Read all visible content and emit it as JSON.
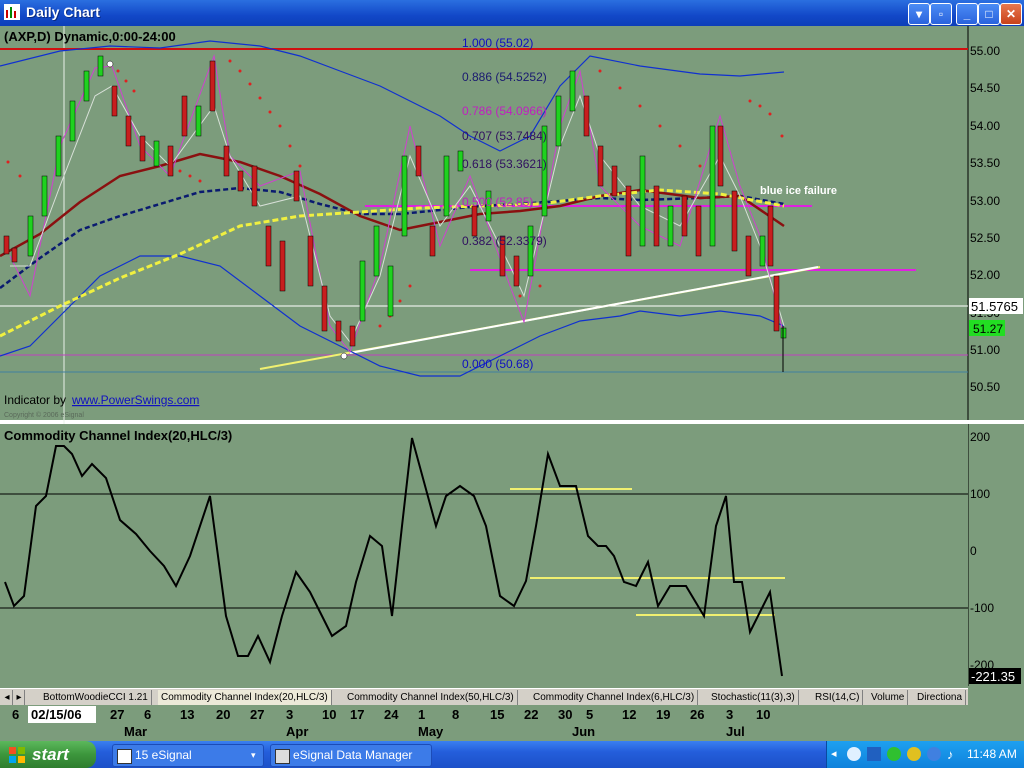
{
  "window": {
    "title": "Daily Chart"
  },
  "chart": {
    "header": "(AXP,D) Dynamic,0:00-24:00",
    "indicator_by": "Indicator by",
    "link": "www.PowerSwings.com",
    "copyright": "Copyright © 2006 eSignal",
    "annotation": "blue ice failure",
    "fib_labels": [
      "1.000 (55.02)",
      "0.886 (54.5252)",
      "0.786 (54.0966)",
      "0.707 (53.7484)",
      "0.618 (53.3621)",
      "0.500 (52.85)",
      "0.382 (52.3379)",
      "0.000 (50.68)"
    ],
    "price_ticks": [
      "55.00",
      "54.50",
      "54.00",
      "53.50",
      "53.00",
      "52.50",
      "52.00",
      "51.50",
      "51.00",
      "50.50"
    ],
    "last_price": "51.5765",
    "current_price": "51.27",
    "colors": {
      "background": "#7c9c7c",
      "bull": "#1fd21f",
      "bear": "#c81e1e",
      "fib_line": "#d01010",
      "magenta": "#d020d0",
      "yellow": "#f0f060"
    }
  },
  "cci": {
    "title": "Commodity Channel Index(20,HLC/3)",
    "ticks": [
      "200",
      "100",
      "0",
      "-100",
      "-200"
    ],
    "current": "-221.35"
  },
  "tabs": [
    "BottomWoodieCCI 1.21",
    "Commodity Channel Index(20,HLC/3)",
    "Commodity Channel Index(50,HLC/3)",
    "Commodity Channel Index(6,HLC/3)",
    "Stochastic(11(3),3)",
    "RSI(14,C)",
    "Volume",
    "Directiona"
  ],
  "xaxis": {
    "days": [
      "6",
      "02/15/06",
      "27",
      "6",
      "13",
      "20",
      "27",
      "3",
      "10",
      "17",
      "24",
      "1",
      "8",
      "15",
      "22",
      "30",
      "5",
      "12",
      "19",
      "26",
      "3",
      "10"
    ],
    "months": [
      "Mar",
      "Apr",
      "May",
      "Jun",
      "Jul"
    ]
  },
  "taskbar": {
    "start": "start",
    "tasks": [
      "15 eSignal",
      "eSignal Data Manager"
    ],
    "clock": "11:48 AM"
  }
}
